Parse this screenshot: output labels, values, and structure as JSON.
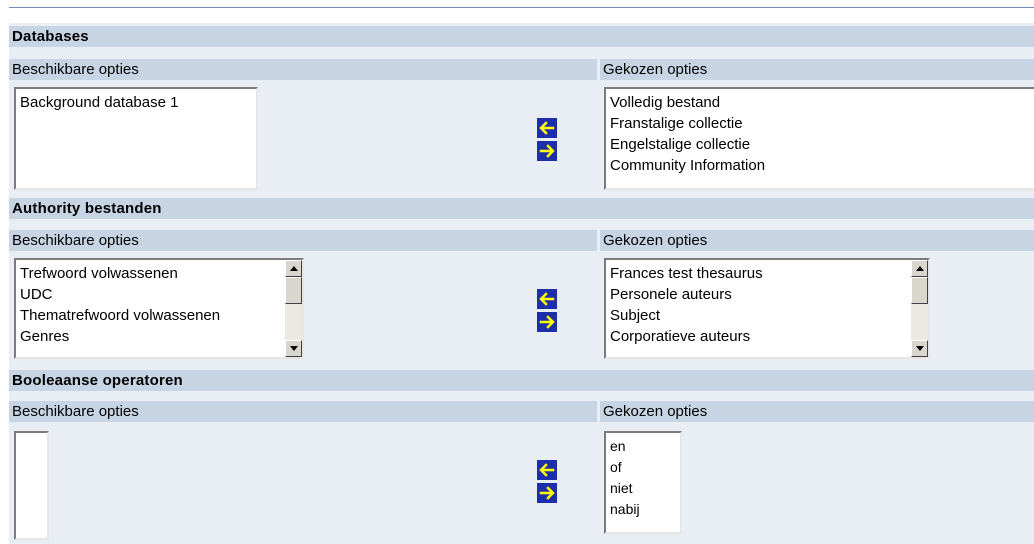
{
  "sections": [
    {
      "title": "Databases",
      "available_label": "Beschikbare opties",
      "chosen_label": "Gekozen opties",
      "available": [
        "Background database 1"
      ],
      "chosen": [
        "Volledig bestand",
        "Franstalige collectie",
        "Engelstalige collectie",
        "Community Information"
      ]
    },
    {
      "title": "Authority bestanden",
      "available_label": "Beschikbare opties",
      "chosen_label": "Gekozen opties",
      "available": [
        "Trefwoord volwassenen",
        "UDC",
        "Thematrefwoord volwassenen",
        "Genres"
      ],
      "chosen": [
        "Frances test thesaurus",
        "Personele auteurs",
        "Subject",
        "Corporatieve auteurs"
      ]
    },
    {
      "title": "Booleaanse operatoren",
      "available_label": "Beschikbare opties",
      "chosen_label": "Gekozen opties",
      "available": [],
      "chosen": [
        "en",
        "of",
        "niet",
        "nabij"
      ]
    }
  ],
  "colors": {
    "header_bg": "#c6d4e4",
    "panel_bg": "#e9eef5",
    "arrow_bg": "#1c2fa8",
    "arrow_fg": "#ffff00"
  },
  "icons": {
    "move_left": "arrow-left-icon",
    "move_right": "arrow-right-icon"
  }
}
